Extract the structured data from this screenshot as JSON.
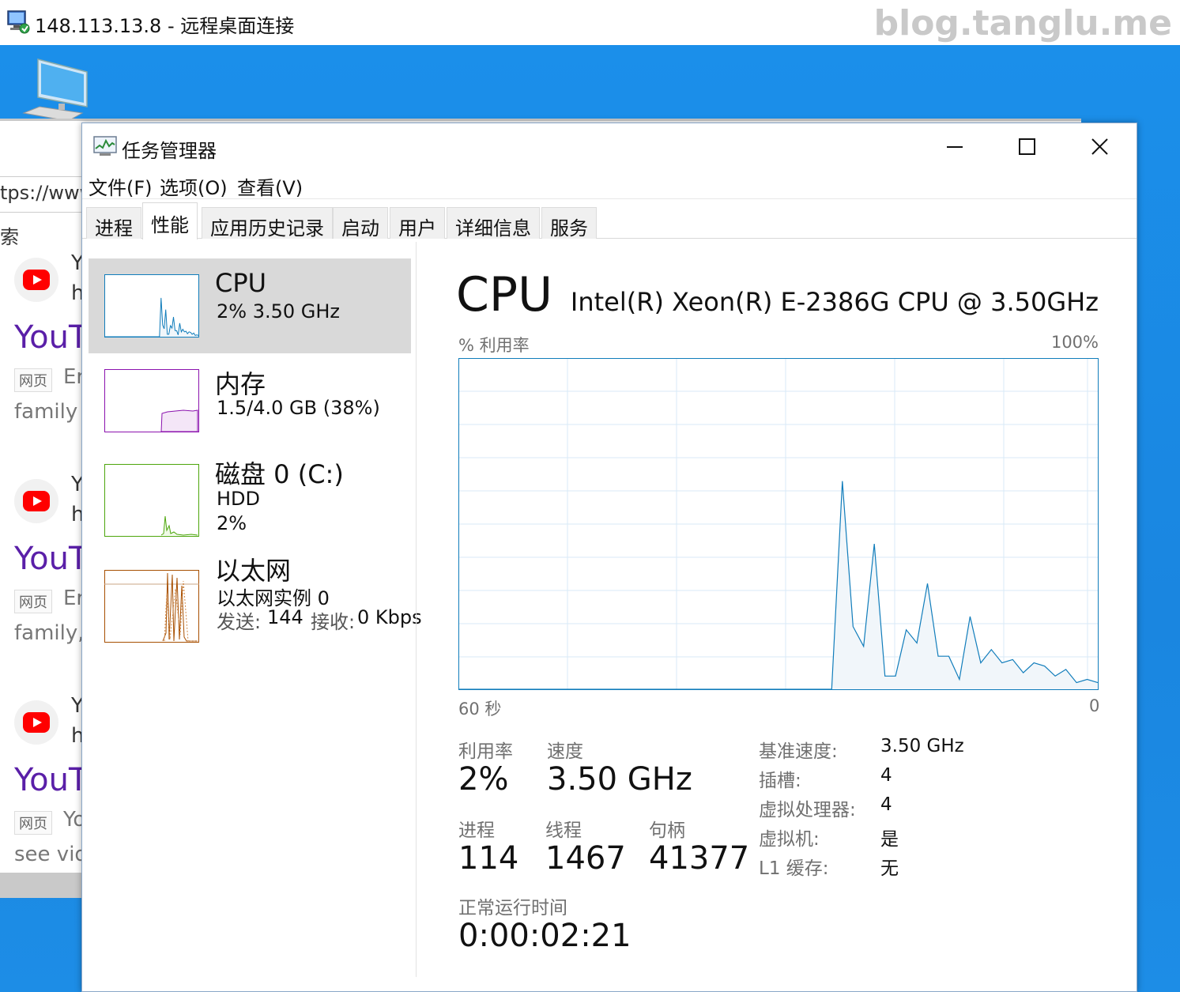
{
  "rdp": {
    "title": "148.113.13.8 - 远程桌面连接",
    "watermark": "blog.tanglu.me"
  },
  "browser": {
    "url_fragment": "tps://www",
    "side_char": "索",
    "results": [
      {
        "letter1": "Y",
        "letter2": "h",
        "title": "YouT",
        "tag": "网页",
        "tag_text": "Er",
        "desc": "family a"
      },
      {
        "letter1": "Y",
        "letter2": "h",
        "title": "YouT",
        "tag": "网页",
        "tag_text": "Er",
        "desc": "family,"
      },
      {
        "letter1": "Y",
        "letter2": "h",
        "title": "YouT",
        "tag": "网页",
        "tag_text": "Yo",
        "desc": "see vid"
      }
    ]
  },
  "taskmanager": {
    "title": "任务管理器",
    "menu": [
      "文件(F)",
      "选项(O)",
      "查看(V)"
    ],
    "tabs": [
      "进程",
      "性能",
      "应用历史记录",
      "启动",
      "用户",
      "详细信息",
      "服务"
    ],
    "active_tab": "性能",
    "resources": {
      "cpu": {
        "name": "CPU",
        "sub": "2%  3.50 GHz"
      },
      "memory": {
        "name": "内存",
        "sub": "1.5/4.0 GB (38%)"
      },
      "disk": {
        "name": "磁盘 0 (C:)",
        "sub1": "HDD",
        "sub2": "2%"
      },
      "ethernet": {
        "name": "以太网",
        "sub1": "以太网实例 0",
        "send_label": "发送:",
        "send_value": "144",
        "recv_label": "接收:",
        "recv_value": "0 Kbps"
      }
    },
    "detail": {
      "heading": "CPU",
      "model": "Intel(R) Xeon(R) E-2386G CPU @ 3.50GHz",
      "util_label": "% 利用率",
      "util_max": "100%",
      "time_left": "60 秒",
      "time_right": "0",
      "stats": {
        "utilization": {
          "label": "利用率",
          "value": "2%"
        },
        "speed": {
          "label": "速度",
          "value": "3.50 GHz"
        },
        "processes": {
          "label": "进程",
          "value": "114"
        },
        "threads": {
          "label": "线程",
          "value": "1467"
        },
        "handles": {
          "label": "句柄",
          "value": "41377"
        },
        "uptime": {
          "label": "正常运行时间",
          "value": "0:00:02:21"
        }
      },
      "specs": [
        {
          "label": "基准速度:",
          "value": "3.50 GHz"
        },
        {
          "label": "插槽:",
          "value": "4"
        },
        {
          "label": "虚拟处理器:",
          "value": "4"
        },
        {
          "label": "虚拟机:",
          "value": "是"
        },
        {
          "label": "L1 缓存:",
          "value": "无"
        }
      ]
    },
    "colors": {
      "cpu": "#117dbb",
      "memory": "#8b12ae",
      "disk": "#4da60c",
      "ethernet": "#a74f01"
    }
  },
  "chart_data": {
    "type": "area",
    "x": [
      0,
      1,
      2,
      3,
      4,
      5,
      6,
      7,
      8,
      9,
      10,
      11,
      12,
      13,
      14,
      15,
      16,
      17,
      18,
      19,
      20,
      21,
      22,
      23,
      24,
      25,
      26,
      27,
      28,
      29,
      30,
      31,
      32,
      33,
      34,
      35,
      36,
      37,
      38,
      39,
      40,
      41,
      42,
      43,
      44,
      45,
      46,
      47,
      48,
      49,
      50,
      51,
      52,
      53,
      54,
      55,
      56,
      57,
      58,
      59,
      60
    ],
    "values": [
      0,
      0,
      0,
      0,
      0,
      0,
      0,
      0,
      0,
      0,
      0,
      0,
      0,
      0,
      0,
      0,
      0,
      0,
      0,
      0,
      0,
      0,
      0,
      0,
      0,
      0,
      0,
      0,
      0,
      0,
      0,
      0,
      0,
      0,
      0,
      0,
      63,
      19,
      13,
      44,
      4,
      4,
      18,
      14,
      32,
      10,
      10,
      3,
      22,
      8,
      12,
      8,
      9,
      5,
      8,
      7,
      4,
      6,
      2,
      3,
      2
    ],
    "ylim": [
      0,
      100
    ],
    "xlim": [
      0,
      60
    ],
    "grid": true
  }
}
